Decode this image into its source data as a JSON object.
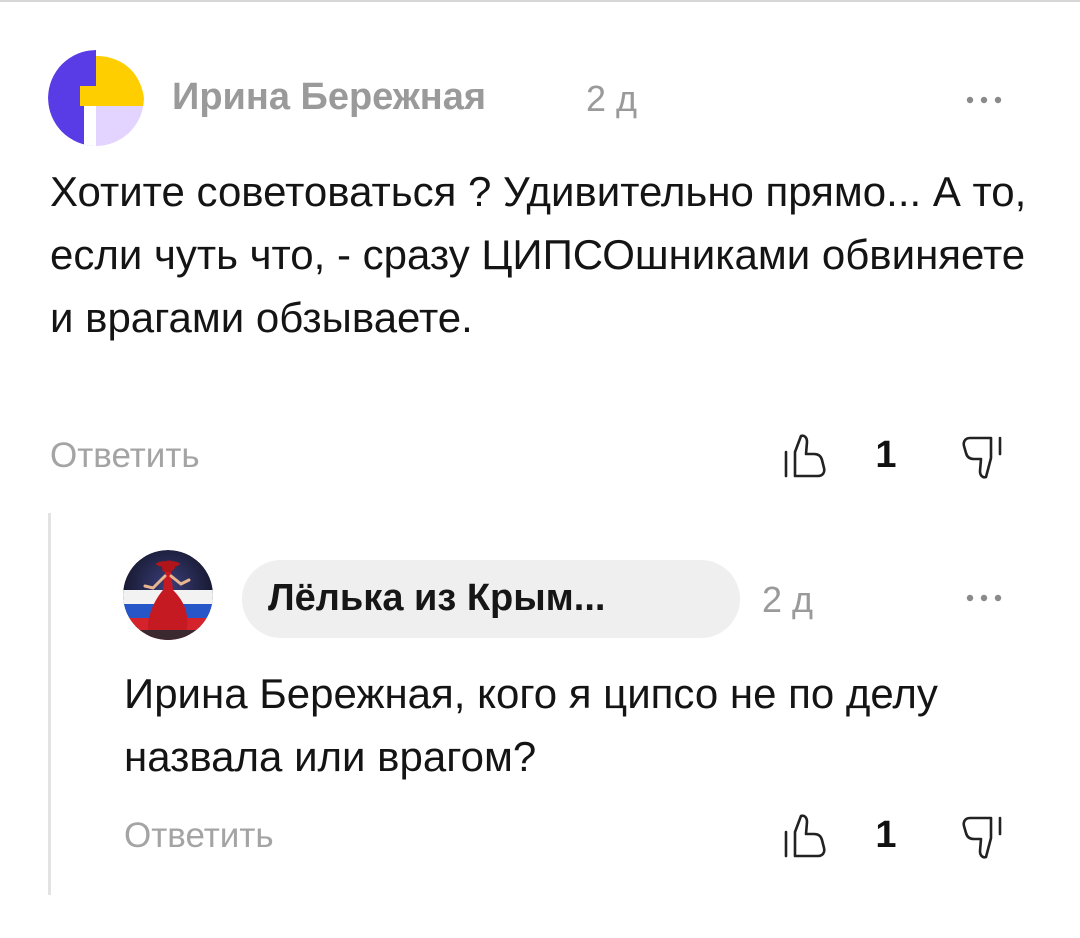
{
  "comments": [
    {
      "author": "Ирина Бережная",
      "time": "2 д",
      "text": "Хотите советоваться ? Удивительно прямо... А то, если чуть что, - сразу ЦИПСОшниками обвиняете и врагами обзываете.",
      "reply_label": "Ответить",
      "likes": "1",
      "avatar_icon": "default-avatar-icon",
      "colors": {
        "avatar_blue": "#5a3ce6",
        "avatar_yellow": "#ffce00",
        "avatar_lavender": "#e3d4ff"
      }
    },
    {
      "author": "Лёлька из Крым...",
      "time": "2 д",
      "text": "Ирина Бережная, кого я ципсо не по делу назвала или врагом?",
      "reply_label": "Ответить",
      "likes": "1",
      "avatar_icon": "user-photo-avatar"
    }
  ],
  "icons": {
    "more": "more-dots-icon",
    "like": "thumbs-up-icon",
    "dislike": "thumbs-down-icon"
  }
}
